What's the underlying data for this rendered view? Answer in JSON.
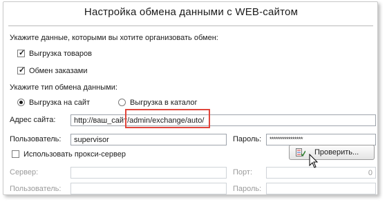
{
  "title": "Настройка обмена данными с WEB-сайтом",
  "prompt_exchange": "Укажите данные, которыми вы хотите организовать обмен:",
  "checkboxes": [
    {
      "label": "Выгрузка товаров",
      "checked": true
    },
    {
      "label": "Обмен заказами",
      "checked": true
    }
  ],
  "prompt_type": "Укажите тип обмена данными:",
  "radios": [
    {
      "label": "Выгрузка на сайт",
      "selected": true
    },
    {
      "label": "Выгрузка в каталог",
      "selected": false
    }
  ],
  "site": {
    "label": "Адрес сайта:",
    "value": "http://ваш_сайт/admin/exchange/auto/"
  },
  "user": {
    "label": "Пользователь:",
    "value": "supervisor"
  },
  "password": {
    "label": "Пароль:",
    "value": "****************"
  },
  "proxy_checkbox": {
    "label": "Использовать прокси-сервер",
    "checked": false
  },
  "check_button": {
    "label": "Проверить...",
    "icon": "checklist-icon"
  },
  "proxy": {
    "server_label": "Сервер:",
    "port_label": "Порт:",
    "port_value": "0",
    "user_label": "Пользователь:",
    "password_label": "Пароль:"
  },
  "colors": {
    "highlight": "#e0453b"
  }
}
